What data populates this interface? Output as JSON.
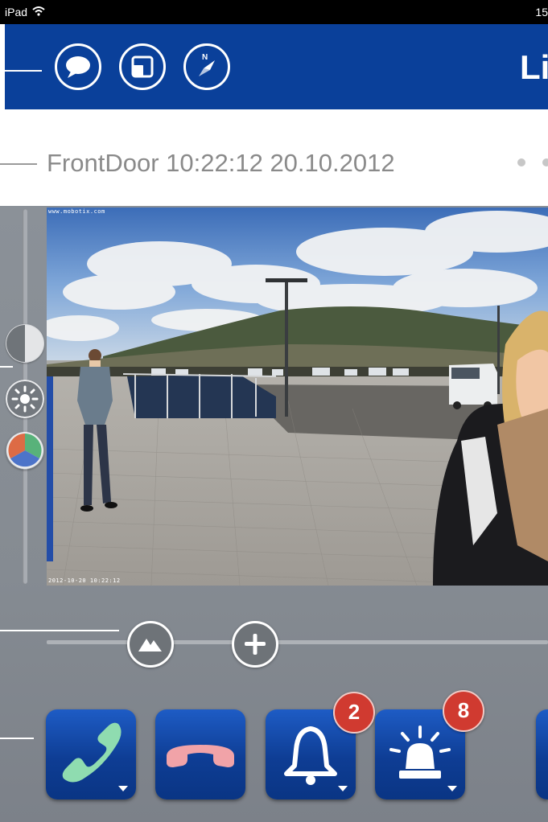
{
  "status_bar": {
    "device": "iPad",
    "time": "15"
  },
  "header": {
    "buttons": [
      {
        "name": "chat-button",
        "icon": "speech-bubble-icon"
      },
      {
        "name": "layout-button",
        "icon": "window-layout-icon"
      },
      {
        "name": "navigate-button",
        "icon": "compass-icon"
      }
    ],
    "title": "Liv"
  },
  "camera": {
    "caption": "FrontDoor 10:22:12 20.10.2012",
    "overlay_top": "www.mobotix.com",
    "overlay_bottom": "2012-10-20 10:22:12"
  },
  "image_controls": [
    {
      "name": "contrast-button",
      "icon": "half-circle-icon"
    },
    {
      "name": "brightness-button",
      "icon": "sun-icon"
    },
    {
      "name": "color-button",
      "icon": "color-wheel-icon"
    }
  ],
  "zoom_controls": [
    {
      "name": "landscape-button",
      "icon": "mountain-icon"
    },
    {
      "name": "zoom-in-button",
      "icon": "plus-icon"
    }
  ],
  "actions": [
    {
      "name": "answer-call-button",
      "icon": "phone-green-icon",
      "badge": ""
    },
    {
      "name": "hang-up-button",
      "icon": "phone-red-icon",
      "badge": ""
    },
    {
      "name": "doorbell-button",
      "icon": "bell-icon",
      "badge": "2"
    },
    {
      "name": "alarm-button",
      "icon": "siren-icon",
      "badge": "8"
    }
  ],
  "colors": {
    "header_blue": "#0a409a",
    "panel_gray": "#878d94",
    "badge_red": "#d03a30",
    "phone_green": "#8fdcb0",
    "phone_red": "#f1a3a8"
  }
}
